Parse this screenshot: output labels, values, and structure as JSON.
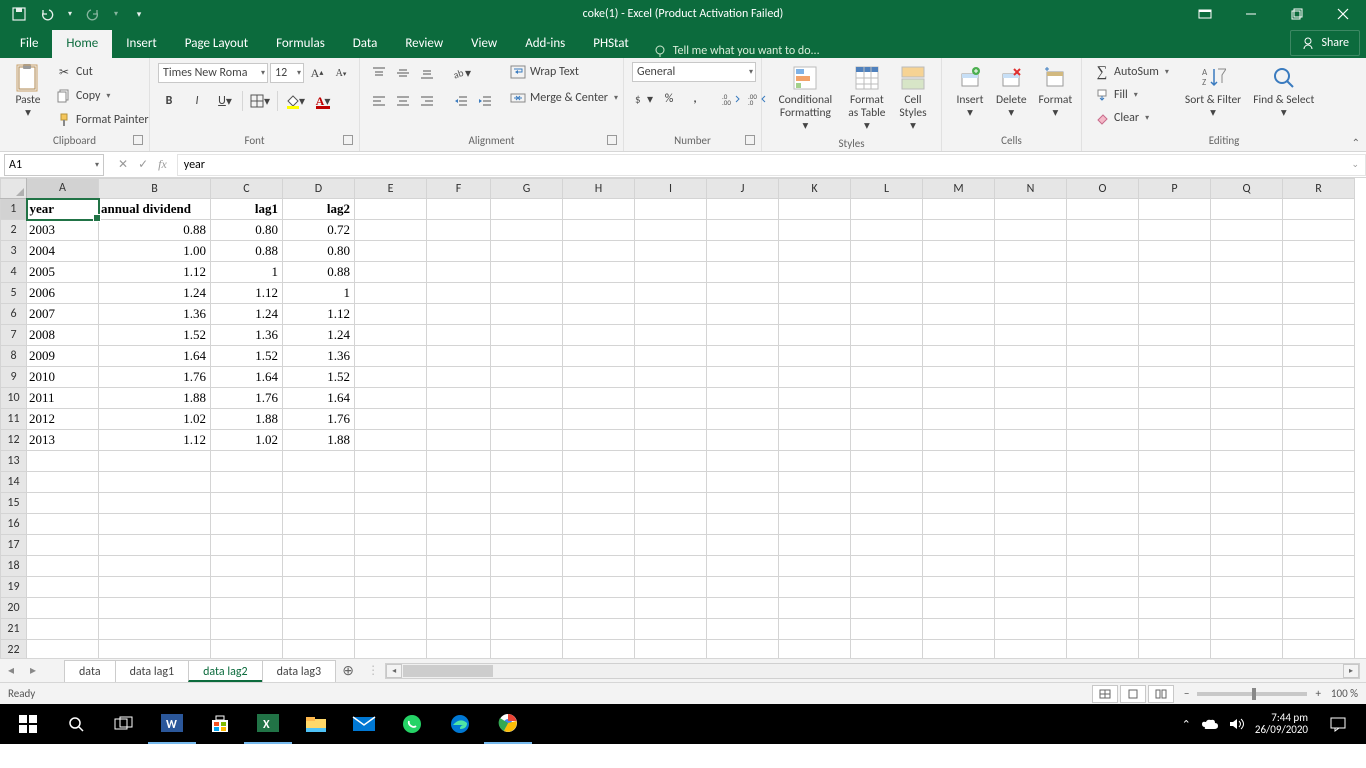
{
  "titlebar": {
    "title": "coke(1) - Excel (Product Activation Failed)"
  },
  "tabs": {
    "file": "File",
    "home": "Home",
    "insert": "Insert",
    "pagelayout": "Page Layout",
    "formulas": "Formulas",
    "data": "Data",
    "review": "Review",
    "view": "View",
    "addins": "Add-ins",
    "phstat": "PHStat"
  },
  "tellme": "Tell me what you want to do...",
  "share": "Share",
  "clipboard": {
    "paste": "Paste",
    "cut": "Cut",
    "copy": "Copy",
    "formatpainter": "Format Painter",
    "label": "Clipboard"
  },
  "font": {
    "name": "Times New Roma",
    "size": "12",
    "label": "Font"
  },
  "alignment": {
    "wrap": "Wrap Text",
    "merge": "Merge & Center",
    "label": "Alignment"
  },
  "number": {
    "format": "General",
    "label": "Number"
  },
  "styles": {
    "cond": "Conditional Formatting",
    "fat": "Format as Table",
    "cell": "Cell Styles",
    "label": "Styles"
  },
  "cells": {
    "insert": "Insert",
    "delete": "Delete",
    "format": "Format",
    "label": "Cells"
  },
  "editing": {
    "autosum": "AutoSum",
    "fill": "Fill",
    "clear": "Clear",
    "sort": "Sort & Filter",
    "find": "Find & Select",
    "label": "Editing"
  },
  "namebox": "A1",
  "formula": "year",
  "columns": [
    "A",
    "B",
    "C",
    "D",
    "E",
    "F",
    "G",
    "H",
    "I",
    "J",
    "K",
    "L",
    "M",
    "N",
    "O",
    "P",
    "Q",
    "R"
  ],
  "rows": [
    1,
    2,
    3,
    4,
    5,
    6,
    7,
    8,
    9,
    10,
    11,
    12,
    13,
    14,
    15,
    16,
    17,
    18,
    19,
    20,
    21,
    22
  ],
  "headers": [
    "year",
    "annual dividend",
    "lag1",
    "lag2"
  ],
  "data": [
    [
      "2003",
      "0.88",
      "0.80",
      "0.72"
    ],
    [
      "2004",
      "1.00",
      "0.88",
      "0.80"
    ],
    [
      "2005",
      "1.12",
      "1",
      "0.88"
    ],
    [
      "2006",
      "1.24",
      "1.12",
      "1"
    ],
    [
      "2007",
      "1.36",
      "1.24",
      "1.12"
    ],
    [
      "2008",
      "1.52",
      "1.36",
      "1.24"
    ],
    [
      "2009",
      "1.64",
      "1.52",
      "1.36"
    ],
    [
      "2010",
      "1.76",
      "1.64",
      "1.52"
    ],
    [
      "2011",
      "1.88",
      "1.76",
      "1.64"
    ],
    [
      "2012",
      "1.02",
      "1.88",
      "1.76"
    ],
    [
      "2013",
      "1.12",
      "1.02",
      "1.88"
    ]
  ],
  "sheets": {
    "s1": "data",
    "s2": "data lag1",
    "s3": "data lag2",
    "s4": "data lag3"
  },
  "status": {
    "ready": "Ready",
    "zoom": "100 %"
  },
  "tray": {
    "time": "7:44 pm",
    "date": "26/09/2020"
  },
  "chart_data": {
    "type": "table",
    "columns": [
      "year",
      "annual dividend",
      "lag1",
      "lag2"
    ],
    "rows": [
      [
        2003,
        0.88,
        0.8,
        0.72
      ],
      [
        2004,
        1.0,
        0.88,
        0.8
      ],
      [
        2005,
        1.12,
        1.0,
        0.88
      ],
      [
        2006,
        1.24,
        1.12,
        1.0
      ],
      [
        2007,
        1.36,
        1.24,
        1.12
      ],
      [
        2008,
        1.52,
        1.36,
        1.24
      ],
      [
        2009,
        1.64,
        1.52,
        1.36
      ],
      [
        2010,
        1.76,
        1.64,
        1.52
      ],
      [
        2011,
        1.88,
        1.76,
        1.64
      ],
      [
        2012,
        1.02,
        1.88,
        1.76
      ],
      [
        2013,
        1.12,
        1.02,
        1.88
      ]
    ]
  }
}
